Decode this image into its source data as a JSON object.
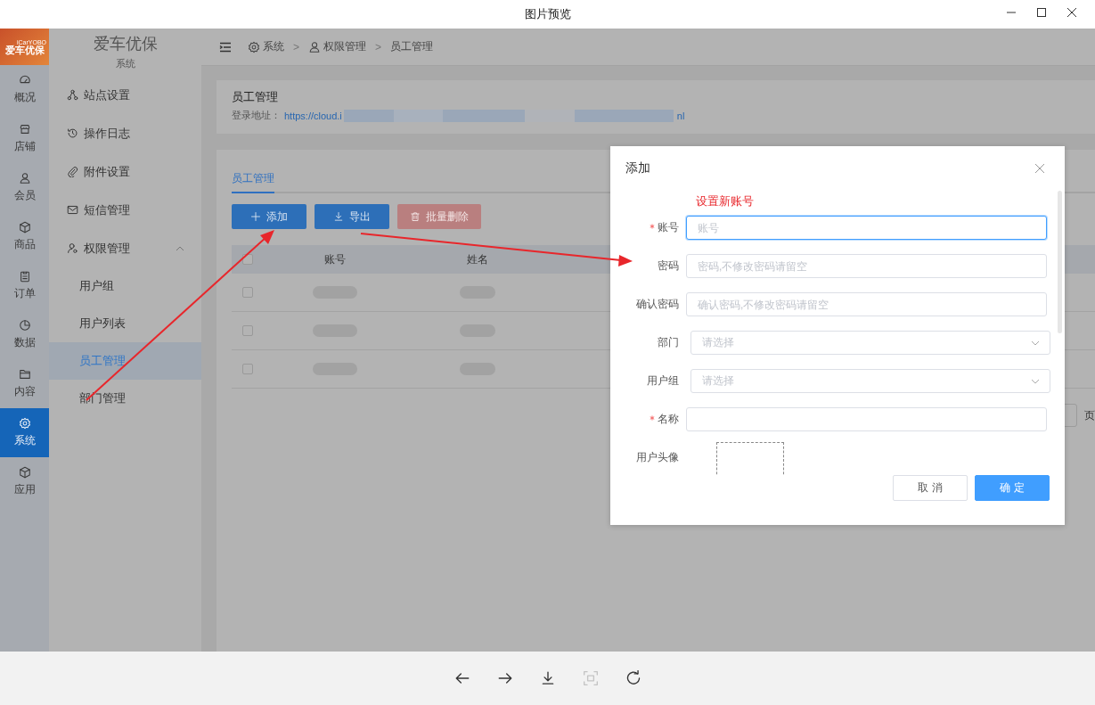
{
  "window": {
    "title": "图片预览"
  },
  "screenshot": {
    "logo": {
      "text": "爱车优保",
      "subtext": "iCarYOBO"
    },
    "rail": [
      {
        "label": "概况",
        "selected": false
      },
      {
        "label": "店铺",
        "selected": false
      },
      {
        "label": "会员",
        "selected": false
      },
      {
        "label": "商品",
        "selected": false
      },
      {
        "label": "订单",
        "selected": false
      },
      {
        "label": "数据",
        "selected": false
      },
      {
        "label": "内容",
        "selected": false
      },
      {
        "label": "系统",
        "selected": true
      },
      {
        "label": "应用",
        "selected": false
      }
    ],
    "sidebar": {
      "title": "爱车优保",
      "subtitle": "系统",
      "items": [
        {
          "label": "站点设置"
        },
        {
          "label": "操作日志"
        },
        {
          "label": "附件设置"
        },
        {
          "label": "短信管理"
        },
        {
          "label": "权限管理",
          "expanded": true,
          "children": [
            {
              "label": "用户组",
              "selected": false
            },
            {
              "label": "用户列表",
              "selected": false
            },
            {
              "label": "员工管理",
              "selected": true
            },
            {
              "label": "部门管理",
              "selected": false
            }
          ]
        }
      ]
    },
    "breadcrumb": [
      {
        "label": "系统",
        "separator": ">"
      },
      {
        "label": "权限管理",
        "separator": ">"
      },
      {
        "label": "员工管理"
      }
    ],
    "header_card": {
      "title": "员工管理",
      "login_label": "登录地址：",
      "url_start": "https://cloud.i",
      "url_end": "nl"
    },
    "tabs": [
      {
        "label": "员工管理",
        "selected": true
      }
    ],
    "buttons": [
      {
        "label": "添加",
        "disabled": false
      },
      {
        "label": "导出",
        "disabled": false
      },
      {
        "label": "批量删除",
        "disabled": true
      }
    ],
    "table": {
      "columns": [
        "账号",
        "姓名"
      ],
      "header_checked": false,
      "rows": [
        {
          "checked": false
        },
        {
          "checked": false
        },
        {
          "checked": false
        }
      ]
    },
    "pagination_fragment": "页",
    "dialog": {
      "title": "添加",
      "annotation": "设置新账号",
      "fields": [
        {
          "label": "账号",
          "required": true,
          "kind": "input",
          "placeholder": "账号",
          "focused": true
        },
        {
          "label": "密码",
          "required": false,
          "kind": "input",
          "placeholder": "密码,不修改密码请留空",
          "focused": false
        },
        {
          "label": "确认密码",
          "required": false,
          "kind": "input",
          "placeholder": "确认密码,不修改密码请留空",
          "focused": false
        },
        {
          "label": "部门",
          "required": false,
          "kind": "select",
          "placeholder": "请选择"
        },
        {
          "label": "用户组",
          "required": false,
          "kind": "select",
          "placeholder": "请选择"
        },
        {
          "label": "名称",
          "required": true,
          "kind": "input",
          "focused": false
        },
        {
          "label": "用户头像",
          "required": false,
          "kind": "upload"
        }
      ],
      "buttons": [
        {
          "label": "取 消",
          "primary": false
        },
        {
          "label": "确 定",
          "primary": true
        }
      ]
    }
  },
  "toolbar": [
    {
      "disabled": false
    },
    {
      "disabled": false
    },
    {
      "disabled": false
    },
    {
      "disabled": true
    },
    {
      "disabled": false
    }
  ]
}
